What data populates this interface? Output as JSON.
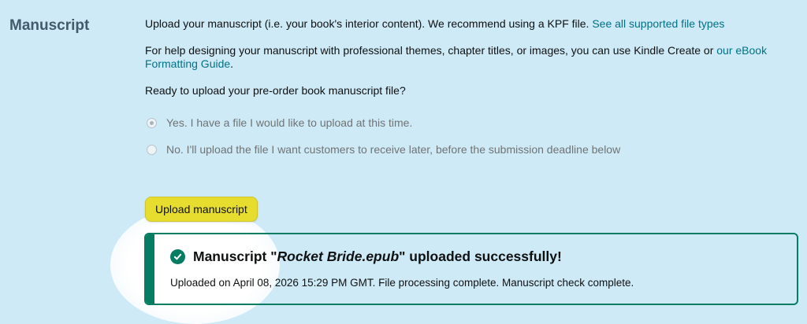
{
  "section": {
    "label": "Manuscript"
  },
  "intro": {
    "text": "Upload your manuscript (i.e. your book's interior content). We recommend using a KPF file. ",
    "link": "See all supported file types"
  },
  "help": {
    "text": "For help designing your manuscript with professional themes, chapter titles, or images, you can use Kindle Create or ",
    "link": "our eBook Formatting Guide",
    "suffix": "."
  },
  "question": "Ready to upload your pre-order book manuscript file?",
  "options": [
    {
      "label": "Yes. I have a file I would like to upload at this time.",
      "selected": true
    },
    {
      "label": "No. I'll upload the file I want customers to receive later, before the submission deadline below",
      "selected": false
    }
  ],
  "upload_button": "Upload manuscript",
  "alert": {
    "prefix": "Manuscript \"",
    "filename": "Rocket Bride.epub",
    "suffix": "\" uploaded successfully!",
    "detail": "Uploaded on April 08, 2026 15:29 PM GMT. File processing complete. Manuscript check complete."
  },
  "icons": {
    "success": "check-circle-icon"
  },
  "colors": {
    "link": "#007185",
    "success": "#067d62",
    "button": "#e7dd2f",
    "background": "#cfeaf7"
  }
}
